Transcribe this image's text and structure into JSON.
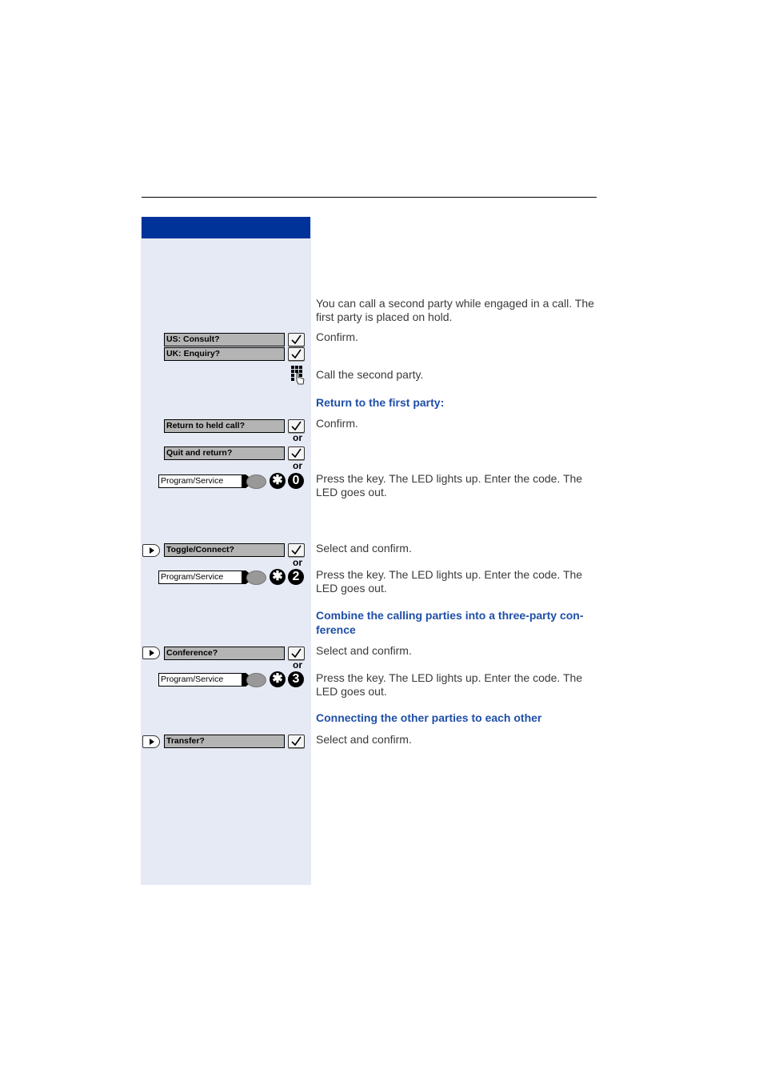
{
  "sidebar": {
    "steps": {
      "consult_us": "US: Consult?",
      "enquiry_uk": "UK: Enquiry?",
      "return_held": "Return to held call?",
      "quit_return": "Quit and return?",
      "program_service_1": "Program/Service",
      "toggle_connect": "Toggle/Connect?",
      "program_service_2": "Program/Service",
      "conference": "Conference?",
      "program_service_3": "Program/Service",
      "transfer": "Transfer?"
    },
    "codes": {
      "star": "✱",
      "code_1": "0",
      "code_2": "2",
      "code_3": "3"
    },
    "or_label": "or",
    "icons": [
      "confirm-check-icon",
      "keypad-icon",
      "select-arrow-icon",
      "led-icon",
      "star-key-icon",
      "digit-key-icon"
    ]
  },
  "main": {
    "intro": "You can call a second party while engaged in a call. The first party is placed on hold.",
    "confirm_1": "Confirm.",
    "call_second": "Call the second party.",
    "heading_return": "Return to the first party:",
    "confirm_2": "Confirm.",
    "press_key_1": "Press the key. The LED lights up. Enter the code. The LED goes out.",
    "select_confirm_1": "Select and confirm.",
    "press_key_2": "Press the key. The LED lights up. Enter the code. The LED goes out.",
    "heading_conference": "Combine the calling parties into a three-party con-ference",
    "select_confirm_2": "Select and confirm.",
    "press_key_3": "Press the key. The LED lights up. Enter the code. The LED goes out.",
    "heading_connect": "Connecting the other parties to each other",
    "select_confirm_3": "Select and confirm."
  },
  "colors": {
    "accent": "#003399",
    "heading": "#1f4fa8",
    "sidebar_bg": "#e6eaf5",
    "display_bg": "#b4b4b4"
  }
}
